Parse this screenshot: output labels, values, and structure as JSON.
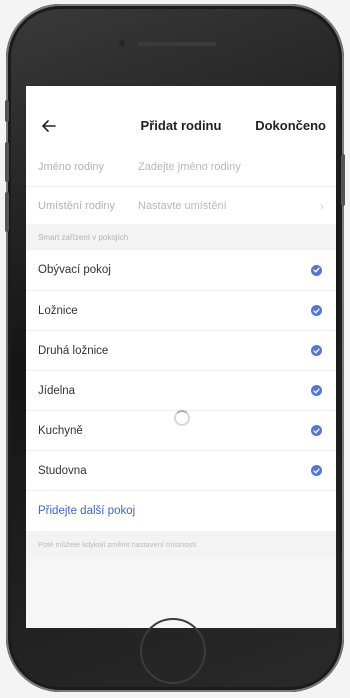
{
  "header": {
    "title": "Přidat rodinu",
    "done_label": "Dokončeno"
  },
  "form": {
    "name_label": "Jméno rodiny",
    "name_placeholder": "Zadejte jméno rodiny",
    "location_label": "Umístění rodiny",
    "location_placeholder": "Nastavte umístění"
  },
  "rooms_section": {
    "title": "Smart zařízení v pokojích",
    "rooms": [
      {
        "label": "Obývací pokoj",
        "checked": true
      },
      {
        "label": "Ložnice",
        "checked": true
      },
      {
        "label": "Druhá ložnice",
        "checked": true
      },
      {
        "label": "Jídelna",
        "checked": true
      },
      {
        "label": "Kuchyně",
        "checked": true
      },
      {
        "label": "Studovna",
        "checked": true
      }
    ],
    "add_room_label": "Přidejte další pokoj"
  },
  "hint": "Poté můžete kdykoli změnit nastavení místnosti",
  "colors": {
    "accent": "#5577d4",
    "link": "#3d66c4"
  }
}
